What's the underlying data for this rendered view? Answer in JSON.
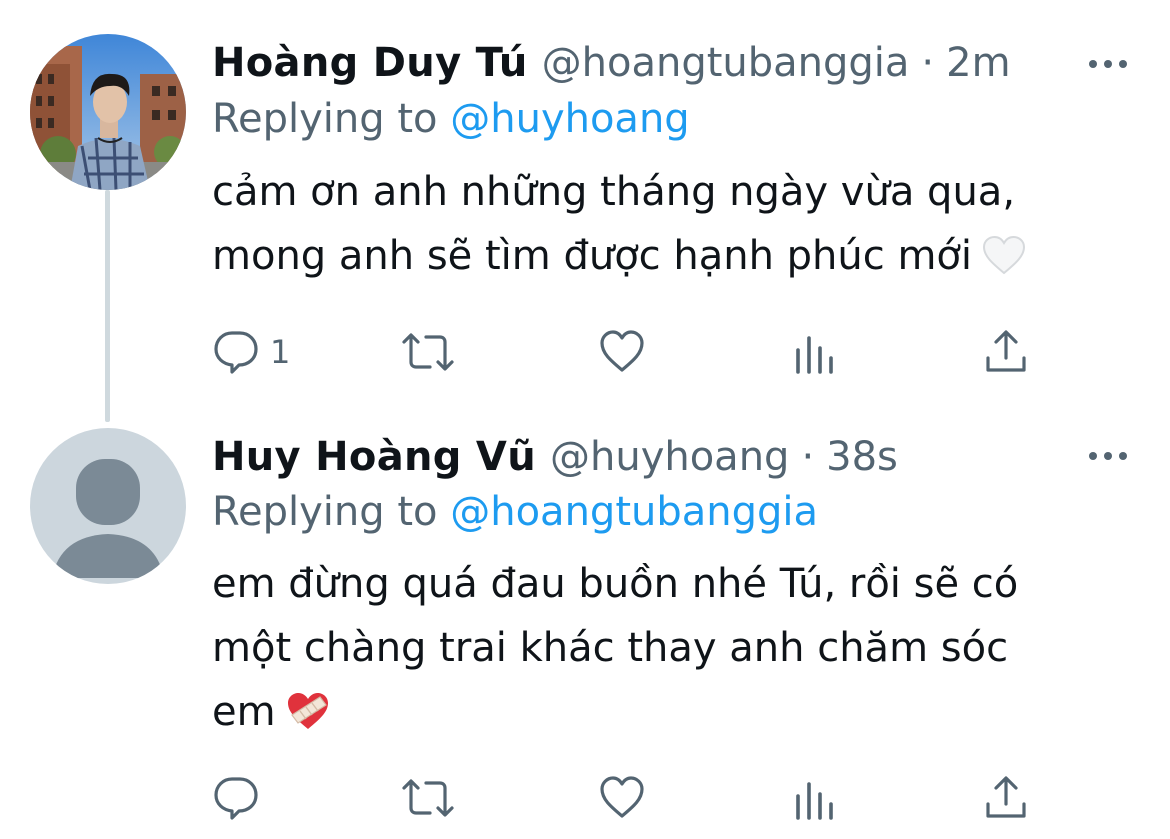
{
  "tweets": [
    {
      "display_name": "Hoàng Duy Tú",
      "handle": "@hoangtubanggia",
      "separator": "·",
      "time": "2m",
      "replying_prefix": "Replying to ",
      "replying_to": "@huyhoang",
      "text_lines": [
        "cảm ơn anh những tháng ngày vừa qua,",
        "mong anh sẽ tìm được hạnh phúc mới"
      ],
      "emoji": "white-heart-icon",
      "reply_count": "1",
      "avatar": "user-photo"
    },
    {
      "display_name": "Huy Hoàng Vũ",
      "handle": "@huyhoang",
      "separator": "·",
      "time": "38s",
      "replying_prefix": "Replying to ",
      "replying_to": "@hoangtubanggia",
      "text_lines": [
        "em đừng quá đau buồn nhé Tú, rồi sẽ có",
        "một chàng trai khác thay anh chăm sóc",
        "em"
      ],
      "emoji": "mending-heart-icon",
      "reply_count": "",
      "avatar": "default-profile-silhouette"
    }
  ],
  "colors": {
    "text_primary": "#0f1419",
    "text_secondary": "#536471",
    "link": "#1d9bf0",
    "thread_line": "#cfd9de",
    "default_avatar_bg": "#ccd6dd",
    "default_avatar_fg": "#7b8a96"
  },
  "action_icons": [
    "reply-icon",
    "retweet-icon",
    "like-icon",
    "analytics-icon",
    "share-icon"
  ]
}
